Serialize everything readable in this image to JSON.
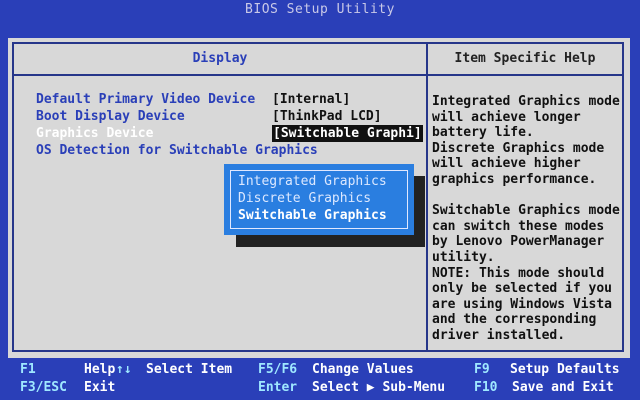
{
  "window": {
    "title": "BIOS Setup Utility"
  },
  "panel": {
    "left_header": "Display",
    "right_header": "Item Specific Help"
  },
  "menu": {
    "items": [
      {
        "label": "Default Primary Video Device",
        "value": "[Internal]"
      },
      {
        "label": "Boot Display Device",
        "value": "[ThinkPad LCD]"
      },
      {
        "label": "Graphics Device",
        "value": "[Switchable Graphi]"
      },
      {
        "label": "OS Detection for Switchable Graphics",
        "value": ""
      }
    ]
  },
  "popup": {
    "options": [
      "Integrated Graphics",
      "Discrete Graphics",
      "Switchable Graphics"
    ],
    "selected": "Switchable Graphics"
  },
  "help": {
    "text": "Integrated Graphics mode\nwill achieve longer\nbattery life.\nDiscrete Graphics mode\nwill achieve higher\ngraphics performance.\n\nSwitchable Graphics mode\ncan switch these modes\nby Lenovo PowerManager\nutility.\nNOTE: This mode should\nonly be selected if you\nare using Windows Vista\nand the corresponding\ndriver installed."
  },
  "keys": {
    "f1": "F1",
    "help": "Help",
    "arrows": "↑↓",
    "select_item": "Select Item",
    "f5f6": "F5/F6",
    "change_values": "Change Values",
    "f9": "F9",
    "setup_defaults": "Setup Defaults",
    "f3esc": "F3/ESC",
    "exit": "Exit",
    "enter": "Enter",
    "select_submenu": "Select ▶ Sub-Menu",
    "f10": "F10",
    "save_exit": "Save and Exit"
  },
  "colors": {
    "background": "#2a3fb8",
    "panel": "#d8d8d8",
    "popup": "#2a7ee0",
    "key_highlight": "#9fe8ff"
  }
}
